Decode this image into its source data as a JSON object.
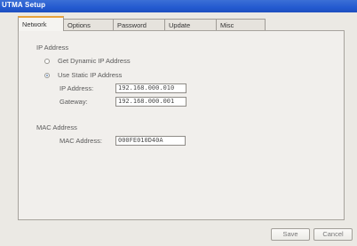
{
  "window": {
    "title": "UTMA Setup"
  },
  "tabs": [
    {
      "label": "Network",
      "active": true
    },
    {
      "label": "Options",
      "active": false
    },
    {
      "label": "Password",
      "active": false
    },
    {
      "label": "Update",
      "active": false
    },
    {
      "label": "Misc",
      "active": false
    }
  ],
  "ip_section": {
    "heading": "IP Address",
    "dynamic_option": {
      "label": "Get Dynamic IP Address",
      "selected": false
    },
    "static_option": {
      "label": "Use Static IP Address",
      "selected": true
    },
    "ip_address": {
      "label": "IP Address:",
      "value": "192.168.000.010"
    },
    "gateway": {
      "label": "Gateway:",
      "value": "192.168.000.001"
    }
  },
  "mac_section": {
    "heading": "MAC Address",
    "mac_address": {
      "label": "MAC Address:",
      "value": "000FE010D40A"
    }
  },
  "buttons": {
    "save_label": "Save",
    "cancel_label": "Cancel"
  },
  "colors": {
    "titlebar": "#245ad0",
    "active_tab_accent": "#e8a23c",
    "window_bg": "#ebe9e4"
  }
}
